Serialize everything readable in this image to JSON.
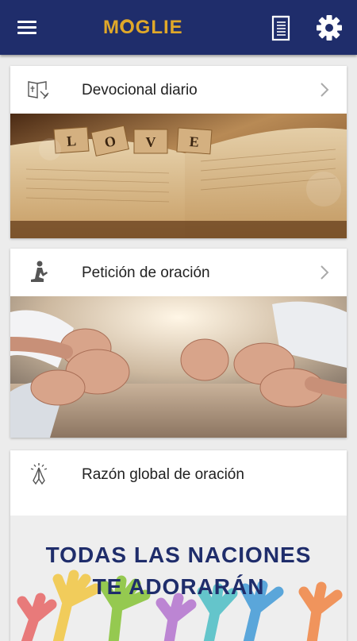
{
  "app": {
    "logo_text": "MOGLIE"
  },
  "header": {
    "menu_icon": "hamburger-menu-icon",
    "book_icon": "book-icon",
    "settings_icon": "gear-icon"
  },
  "colors": {
    "appbar": "#1f2d6b",
    "logo": "#e0a829",
    "banner_text": "#1f2d6b",
    "label": "#222222"
  },
  "cards": [
    {
      "label": "Devocional diario",
      "icon": "bible-reading-icon",
      "image": "love-tiles-on-bible-photo"
    },
    {
      "label": "Petición de oración",
      "icon": "praying-person-icon",
      "image": "holding-hands-prayer-photo"
    },
    {
      "label": "Razón global de oración",
      "icon": "praying-hands-icon",
      "banner_line1": "TODAS LAS NACIONES",
      "banner_line2": "TE ADORARÁN"
    }
  ],
  "love_tiles": [
    "L",
    "O",
    "V",
    "E"
  ]
}
